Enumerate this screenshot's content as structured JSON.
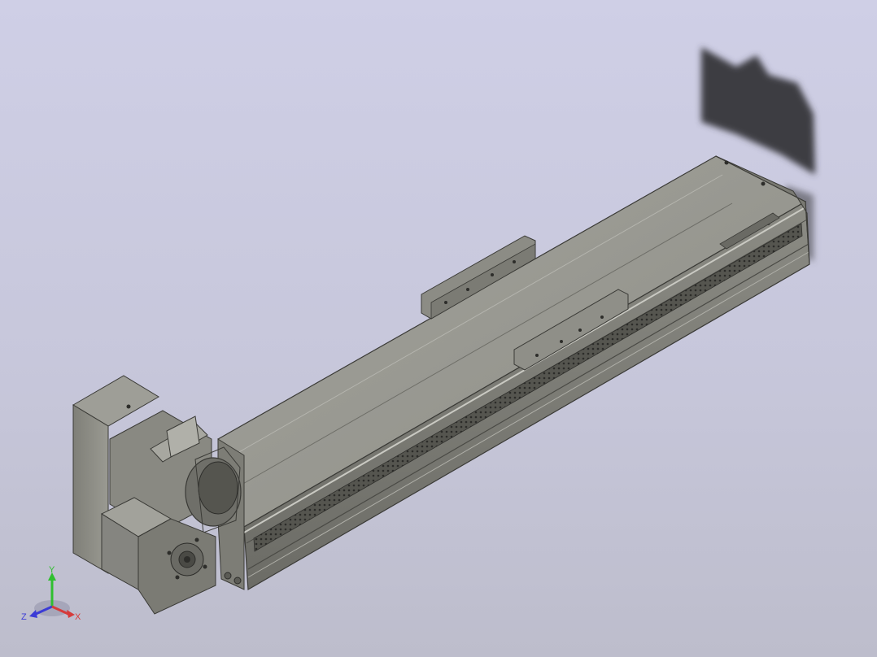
{
  "viewport": {
    "background_top": "#cfcfe6",
    "background_bottom": "#bdbdcc"
  },
  "model": {
    "name": "linear-actuator-with-motor",
    "body_color": "#8a8a84",
    "top_face_color": "#9a9a93",
    "dark_edge_color": "#3a3a36",
    "shadow_color": "#3b3b40"
  },
  "triad": {
    "y_label": "Y",
    "z_label": "Z",
    "x_label": "X",
    "y_color": "#2fbf2f",
    "z_color": "#3b3bd6",
    "x_color": "#d63b3b"
  }
}
